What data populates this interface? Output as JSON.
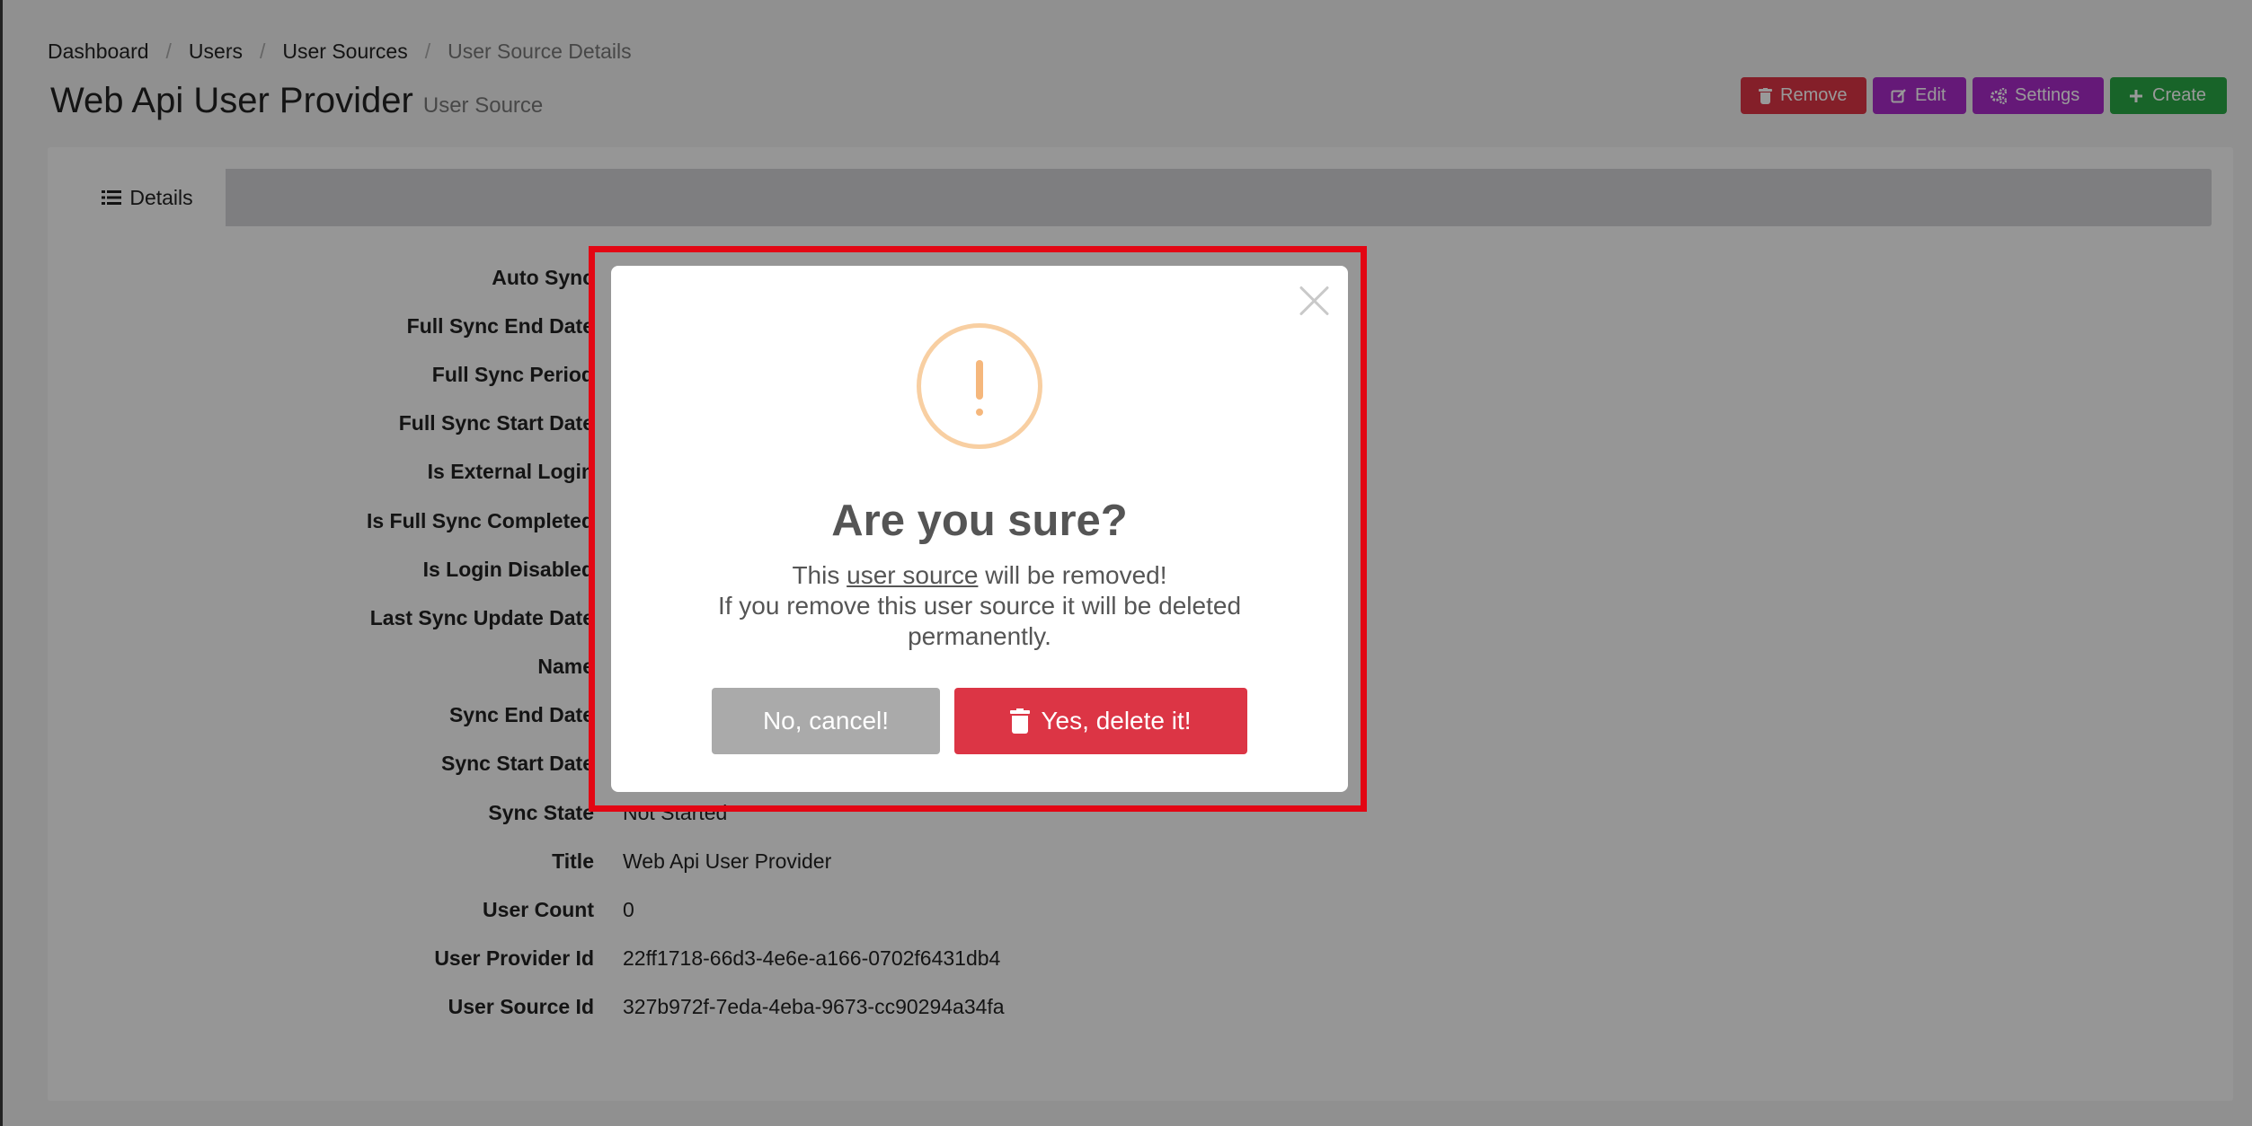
{
  "breadcrumb": [
    "Dashboard",
    "Users",
    "User Sources",
    "User Source Details"
  ],
  "page": {
    "title": "Web Api User Provider",
    "subtitle": "User Source"
  },
  "actions": {
    "remove": "Remove",
    "edit": "Edit",
    "settings": "Settings",
    "create": "Create"
  },
  "tabs": {
    "details": "Details"
  },
  "properties": [
    {
      "label": "Auto Sync",
      "value": ""
    },
    {
      "label": "Full Sync End Date",
      "value": ""
    },
    {
      "label": "Full Sync Period",
      "value": ""
    },
    {
      "label": "Full Sync Start Date",
      "value": ""
    },
    {
      "label": "Is External Login",
      "value": ""
    },
    {
      "label": "Is Full Sync Completed",
      "value": ""
    },
    {
      "label": "Is Login Disabled",
      "value": ""
    },
    {
      "label": "Last Sync Update Date",
      "value": ""
    },
    {
      "label": "Name",
      "value": ""
    },
    {
      "label": "Sync End Date",
      "value": ""
    },
    {
      "label": "Sync Start Date",
      "value": ""
    },
    {
      "label": "Sync State",
      "value": "Not Started"
    },
    {
      "label": "Title",
      "value": "Web Api User Provider"
    },
    {
      "label": "User Count",
      "value": "0"
    },
    {
      "label": "User Provider Id",
      "value": "22ff1718-66d3-4e6e-a166-0702f6431db4"
    },
    {
      "label": "User Source Id",
      "value": "327b972f-7eda-4eba-9673-cc90294a34fa"
    }
  ],
  "modal": {
    "title": "Are you sure?",
    "text_prefix": "This",
    "text_link": "user source",
    "text_suffix": "will be removed!",
    "text_line2": "If you remove this user source it will be deleted permanently.",
    "cancel_label": "No, cancel!",
    "confirm_label": "Yes, delete it!"
  },
  "colors": {
    "danger": "#dc3545",
    "purple": "#a82ac8",
    "success": "#28a745",
    "warning_icon": "#f8cfa2",
    "highlight": "#e30613"
  }
}
